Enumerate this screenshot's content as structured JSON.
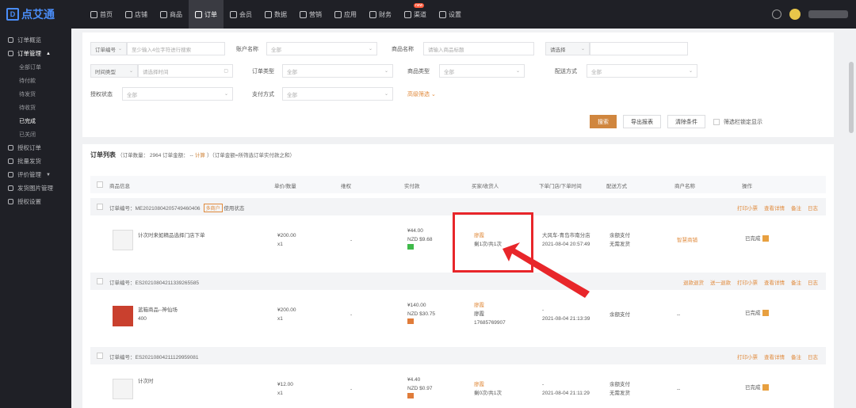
{
  "brand": "点艾通",
  "nav": [
    {
      "label": "首页",
      "icon": "home-icon"
    },
    {
      "label": "店铺",
      "icon": "store-icon"
    },
    {
      "label": "商品",
      "icon": "goods-icon"
    },
    {
      "label": "订单",
      "icon": "order-icon",
      "active": true
    },
    {
      "label": "会员",
      "icon": "member-icon"
    },
    {
      "label": "数据",
      "icon": "data-icon"
    },
    {
      "label": "营销",
      "icon": "marketing-icon"
    },
    {
      "label": "应用",
      "icon": "app-icon"
    },
    {
      "label": "财务",
      "icon": "finance-icon"
    },
    {
      "label": "渠道",
      "icon": "channel-icon",
      "badge": "new"
    },
    {
      "label": "设置",
      "icon": "settings-icon"
    }
  ],
  "sidebar": {
    "items": [
      {
        "label": "订单概览"
      },
      {
        "label": "订单管理",
        "open": true,
        "children": [
          "全部订单",
          "待付款",
          "待发货",
          "待收货",
          "已完成",
          "已关闭"
        ],
        "active_child": 4
      },
      {
        "label": "授权订单"
      },
      {
        "label": "批量发货"
      },
      {
        "label": "评价管理"
      },
      {
        "label": "发货图片管理"
      },
      {
        "label": "授权设置"
      }
    ]
  },
  "filters": {
    "row1": {
      "order_no_select": "订单编号",
      "order_no_placeholder": "至少输入4位字符进行搜索",
      "account_label": "账户名称",
      "account_value": "全部",
      "goods_name_label": "商品名称",
      "goods_name_placeholder": "请输入商品标题",
      "pick_select": "请选择"
    },
    "row2": {
      "time_type": "时间类型",
      "time_placeholder": "请选择时间",
      "order_type_label": "订单类型",
      "order_type_value": "全部",
      "goods_type_label": "商品类型",
      "goods_type_value": "全部",
      "delivery_label": "配送方式",
      "delivery_value": "全部"
    },
    "row3": {
      "auth_label": "授权状态",
      "auth_value": "全部",
      "pay_label": "支付方式",
      "pay_value": "全部",
      "advanced": "高级筛选"
    },
    "actions": {
      "search": "搜索",
      "export": "导出报表",
      "clear": "清除条件",
      "lock": "筛选栏锁定显示"
    }
  },
  "list": {
    "title": "订单列表",
    "summary": "（订单数量： 2964 订单金额： --",
    "calc": "计算",
    "summary_tail": "）（订单金额=所筛选订单实付款之和）",
    "columns": [
      "商品信息",
      "单价/数量",
      "维权",
      "实付款",
      "买家/收货人",
      "下单门店/下单时间",
      "配送方式",
      "商户名称",
      "操作"
    ],
    "orders": [
      {
        "no": "订单编号：ME20210804205749460406",
        "tag": "多商户",
        "status_note": "使用状态",
        "actions": [
          "打印小票",
          "查看详情",
          "备注",
          "日志"
        ],
        "product": "计次时来如精品选择门店下单",
        "price": "¥200.00",
        "qty": "x1",
        "rights": "-",
        "paid": "¥44.00",
        "paid_nzd": "NZD $9.68",
        "buyer": "廖霞",
        "buyer_note": "剩1次/共1次",
        "store": "大风车-青岛市南分店",
        "time": "2021-08-04 20:57:49",
        "delivery": "余额支付",
        "delivery2": "无需发货",
        "merchant": "智慧商铺",
        "status": "已完成"
      },
      {
        "no": "订单编号：ES20210804211339265585",
        "actions": [
          "退款退货",
          "送一退款",
          "打印小票",
          "查看详情",
          "备注",
          "日志"
        ],
        "product": "蓝箱商品--神仙场",
        "product_sub": "400",
        "price": "¥200.00",
        "qty": "x1",
        "rights": "-",
        "paid": "¥140.00",
        "paid_nzd": "NZD $30.75",
        "buyer": "廖霞",
        "buyer2": "廖霞",
        "phone": "17685769907",
        "store": "-",
        "time": "2021-08-04 21:13:39",
        "delivery": "余额支付",
        "merchant": "--",
        "status": "已完成"
      },
      {
        "no": "订单编号：ES20210804211129959081",
        "actions": [
          "打印小票",
          "查看详情",
          "备注",
          "日志"
        ],
        "product": "计次时",
        "price": "¥12.00",
        "qty": "x1",
        "rights": "-",
        "paid": "¥4.40",
        "paid_nzd": "NZD $0.97",
        "buyer": "廖霞",
        "buyer_note": "剩0次/共1次",
        "store": "-",
        "time": "2021-08-04 21:11:29",
        "delivery": "余额支付",
        "delivery2": "无需发货",
        "merchant": "--",
        "status": "已完成"
      }
    ]
  },
  "colors": {
    "accent": "#d0863e",
    "topbar": "#1f2026",
    "highlight": "#e8262a"
  }
}
